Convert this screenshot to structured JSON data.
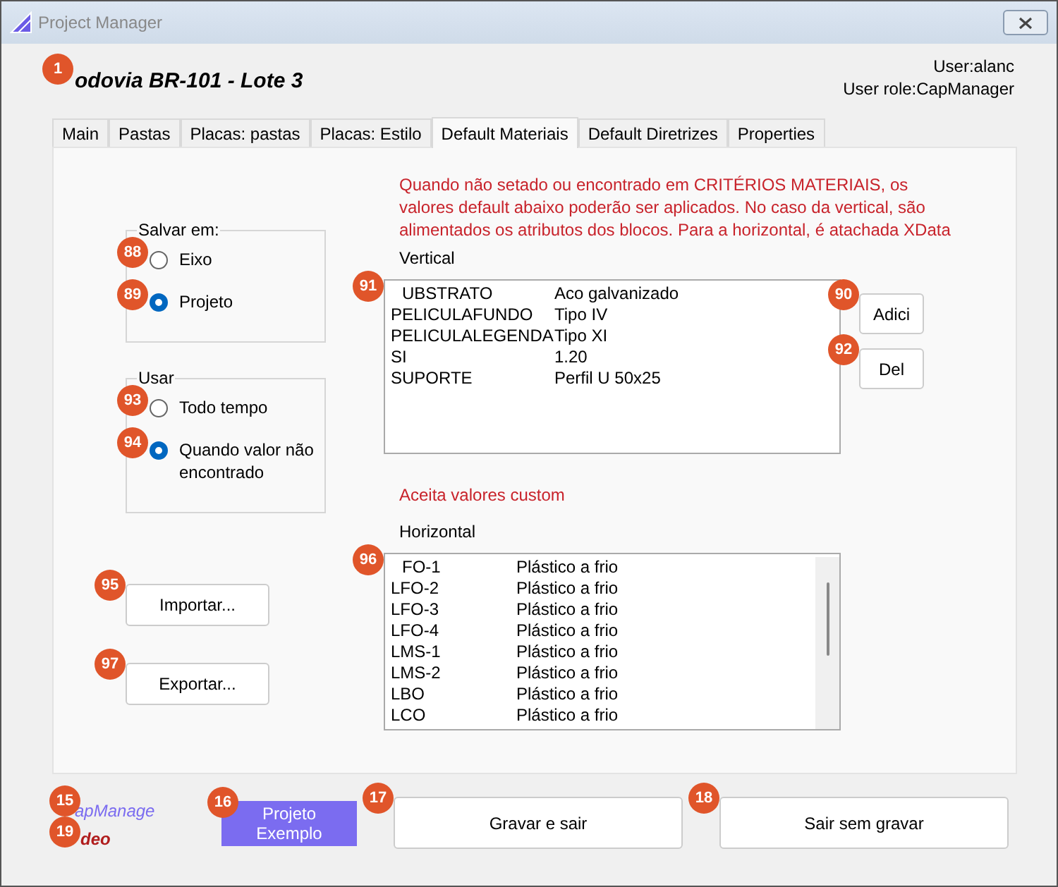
{
  "window": {
    "title": "Project Manager"
  },
  "header": {
    "title": "odovia BR-101 - Lote 3",
    "marker": "1",
    "user": "User:alanc",
    "role": "User role:CapManager"
  },
  "tabs": [
    {
      "label": "Main",
      "selected": false
    },
    {
      "label": "Pastas",
      "selected": false
    },
    {
      "label": "Placas: pastas",
      "selected": false
    },
    {
      "label": "Placas: Estilo",
      "selected": false
    },
    {
      "label": "Default Materiais",
      "selected": true
    },
    {
      "label": "Default Diretrizes",
      "selected": false
    },
    {
      "label": "Properties",
      "selected": false
    }
  ],
  "save_group": {
    "legend": "Salvar em:",
    "options": [
      {
        "label": "Eixo",
        "selected": false,
        "marker": "88"
      },
      {
        "label": "Projeto",
        "selected": true,
        "marker": "89"
      }
    ]
  },
  "use_group": {
    "legend": "Usar",
    "options": [
      {
        "label": "Todo tempo",
        "selected": false,
        "marker": "93"
      },
      {
        "label": "Quando valor não encontrado",
        "selected": true,
        "marker": "94"
      }
    ]
  },
  "import_button": {
    "label": "Importar...",
    "marker": "95"
  },
  "export_button": {
    "label": "Exportar...",
    "marker": "97"
  },
  "notice": "Quando não setado ou encontrado em  CRITÉRIOS MATERIAIS, os valores default abaixo poderão ser aplicados. No caso da vertical, são alimentados os atributos dos blocos. Para a horizontal, é atachada XData",
  "vertical": {
    "label": "Vertical",
    "marker": "91",
    "rows": [
      {
        "name": "UBSTRATO",
        "value": "Aco galvanizado"
      },
      {
        "name": "PELICULAFUNDO",
        "value": "Tipo IV"
      },
      {
        "name": "PELICULALEGENDA",
        "value": "Tipo XI"
      },
      {
        "name": "SI",
        "value": "1.20"
      },
      {
        "name": "SUPORTE",
        "value": "Perfil U 50x25"
      }
    ]
  },
  "add_button": {
    "label": "Adici",
    "marker": "90"
  },
  "del_button": {
    "label": "Del",
    "marker": "92"
  },
  "custom_note": "Aceita valores custom",
  "horizontal": {
    "label": "Horizontal",
    "marker": "96",
    "rows": [
      {
        "name": "FO-1",
        "value": "Plástico a frio"
      },
      {
        "name": "LFO-2",
        "value": "Plástico a frio"
      },
      {
        "name": "LFO-3",
        "value": "Plástico a frio"
      },
      {
        "name": "LFO-4",
        "value": "Plástico a frio"
      },
      {
        "name": "LMS-1",
        "value": "Plástico a frio"
      },
      {
        "name": "LMS-2",
        "value": "Plástico a frio"
      },
      {
        "name": "LBO",
        "value": "Plástico a frio"
      },
      {
        "name": "LCO",
        "value": "Plástico a frio"
      }
    ]
  },
  "footer": {
    "brand": "apManage",
    "brand_marker": "15",
    "company": "deo",
    "company_marker": "19",
    "sample_button": {
      "label": "Projeto Exemplo",
      "marker": "16"
    },
    "save_button": {
      "label": "Gravar e sair",
      "marker": "17"
    },
    "exit_button": {
      "label": "Sair sem gravar",
      "marker": "18"
    }
  }
}
